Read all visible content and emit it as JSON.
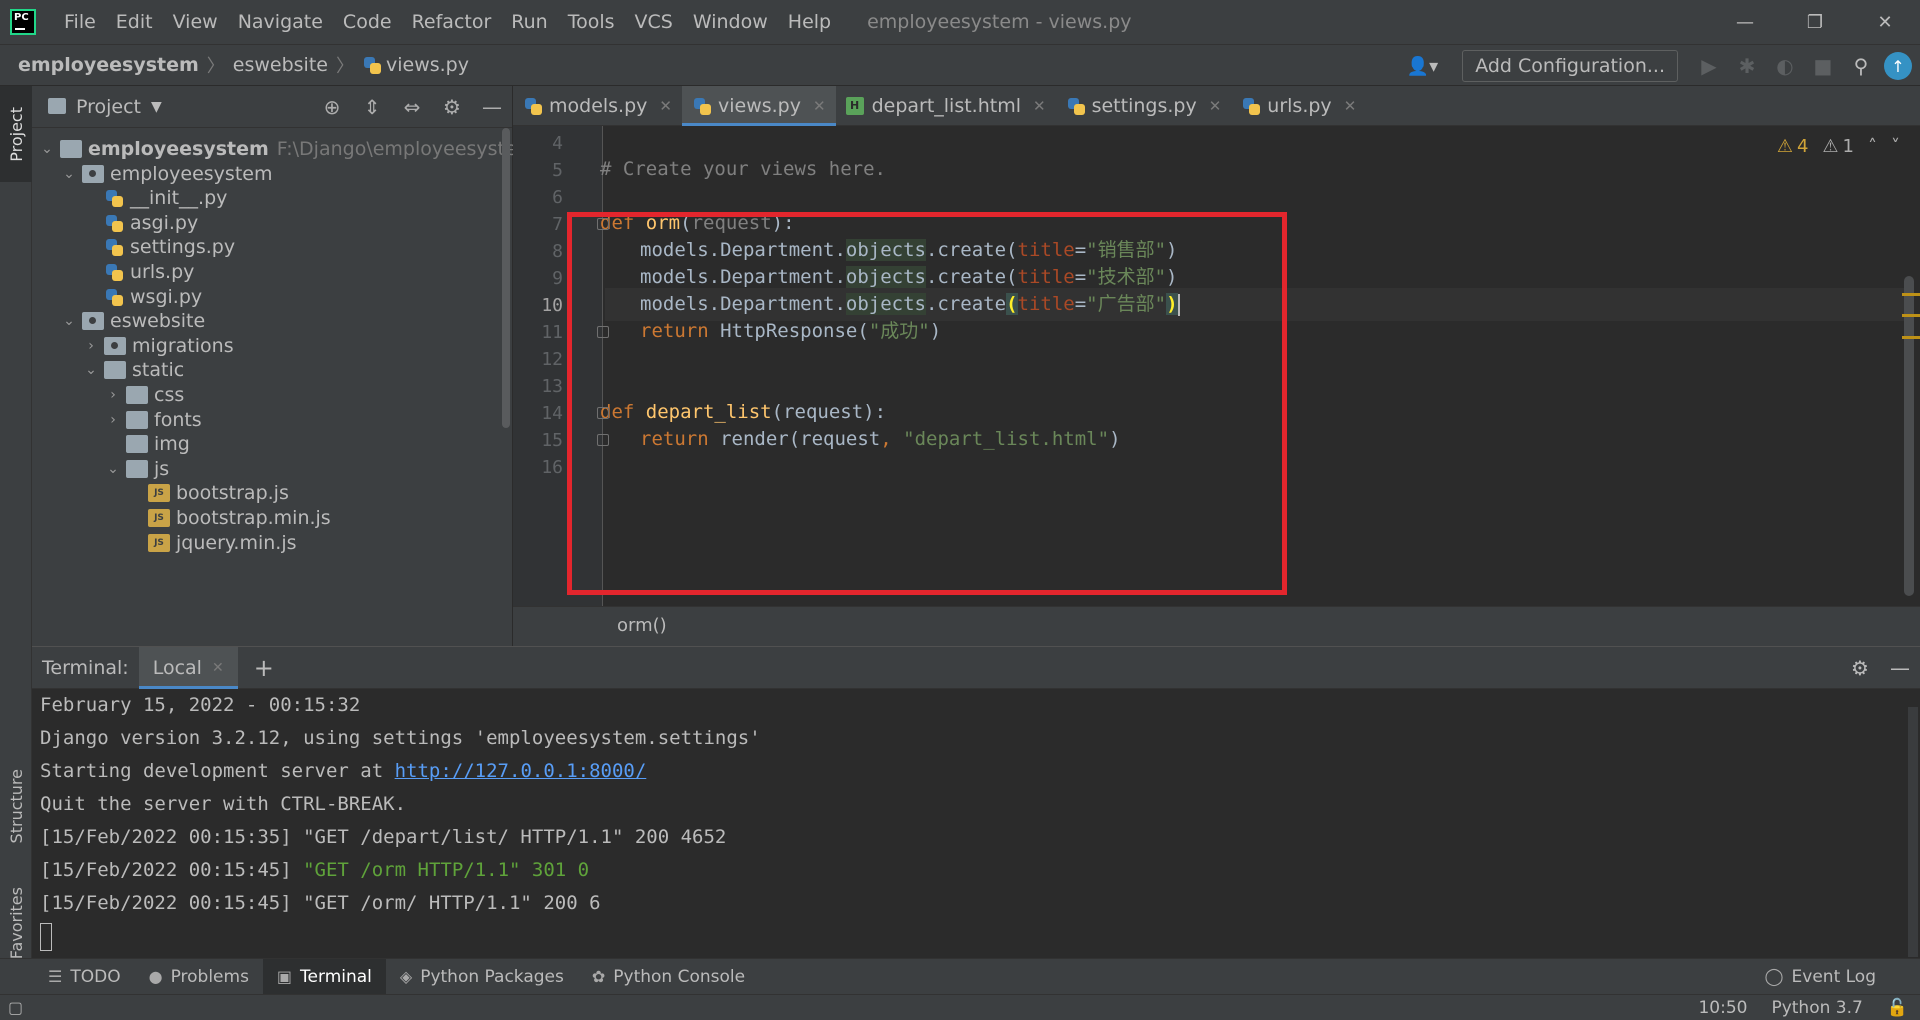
{
  "app": {
    "logo": "PC",
    "window_title": "employeesystem - views.py",
    "menu": [
      "File",
      "Edit",
      "View",
      "Navigate",
      "Code",
      "Refactor",
      "Run",
      "Tools",
      "VCS",
      "Window",
      "Help"
    ],
    "window_controls": {
      "minimize": "—",
      "restore": "❐",
      "close": "✕"
    }
  },
  "navbar": {
    "crumbs": [
      "employeesystem",
      "eswebsite",
      "views.py"
    ],
    "add_configuration": "Add Configuration..."
  },
  "side_tabs": {
    "project": "Project",
    "structure": "Structure",
    "favorites": "Favorites"
  },
  "project": {
    "title": "Project",
    "tree": [
      {
        "label": "employeesystem",
        "sub": "F:\\Django\\employeesystem",
        "type": "folder",
        "arrow": "v"
      },
      {
        "label": "employeesystem",
        "type": "pkg",
        "arrow": "v"
      },
      {
        "label": "__init__.py",
        "type": "py"
      },
      {
        "label": "asgi.py",
        "type": "py"
      },
      {
        "label": "settings.py",
        "type": "py"
      },
      {
        "label": "urls.py",
        "type": "py"
      },
      {
        "label": "wsgi.py",
        "type": "py"
      },
      {
        "label": "eswebsite",
        "type": "pkg",
        "arrow": "v"
      },
      {
        "label": "migrations",
        "type": "pkg",
        "arrow": ">"
      },
      {
        "label": "static",
        "type": "folder",
        "arrow": "v"
      },
      {
        "label": "css",
        "type": "folder",
        "arrow": ">"
      },
      {
        "label": "fonts",
        "type": "folder",
        "arrow": ">"
      },
      {
        "label": "img",
        "type": "folder"
      },
      {
        "label": "js",
        "type": "folder",
        "arrow": "v"
      },
      {
        "label": "bootstrap.js",
        "type": "js"
      },
      {
        "label": "bootstrap.min.js",
        "type": "js"
      },
      {
        "label": "jquery.min.js",
        "type": "js"
      }
    ]
  },
  "editor": {
    "tabs": [
      {
        "label": "models.py",
        "type": "py"
      },
      {
        "label": "views.py",
        "type": "py",
        "active": true
      },
      {
        "label": "depart_list.html",
        "type": "html"
      },
      {
        "label": "settings.py",
        "type": "py"
      },
      {
        "label": "urls.py",
        "type": "py"
      }
    ],
    "line_numbers": [
      "4",
      "5",
      "6",
      "7",
      "8",
      "9",
      "10",
      "11",
      "12",
      "13",
      "14",
      "15",
      "16"
    ],
    "current_line": "10",
    "code": {
      "comment": "# Create your views here.",
      "def_kw": "def",
      "orm_fn": "orm",
      "orm_param": "request",
      "models_prefix": "models.Department.",
      "objects": "objects",
      "create_call": ".create(",
      "title_kw": "title",
      "eq": "=",
      "dept1": "\"销售部\"",
      "dept2": "\"技术部\"",
      "dept3": "\"广告部\"",
      "return_kw": "return",
      "http_response": "HttpResponse(",
      "success": "\"成功\"",
      "depart_fn": "depart_list",
      "render_call": "render(request",
      "template": "\"depart_list.html\""
    },
    "warnings": {
      "warn_count": "4",
      "weak_count": "1"
    },
    "breadcrumb": "orm()"
  },
  "terminal": {
    "label": "Terminal:",
    "tab": "Local",
    "lines": [
      "February 15, 2022 - 00:15:32",
      "Django version 3.2.12, using settings 'employeesystem.settings'",
      "Starting development server at ",
      "Quit the server with CTRL-BREAK.",
      "[15/Feb/2022 00:15:35] \"GET /depart/list/ HTTP/1.1\" 200 4652",
      "[15/Feb/2022 00:15:45] ",
      "[15/Feb/2022 00:15:45] \"GET /orm/ HTTP/1.1\" 200 6"
    ],
    "server_url": "http://127.0.0.1:8000/",
    "redirect_line": "\"GET /orm HTTP/1.1\" 301 0"
  },
  "bottom_tabs": [
    {
      "label": "TODO",
      "icon": "list-icon"
    },
    {
      "label": "Problems",
      "icon": "problems-icon"
    },
    {
      "label": "Terminal",
      "icon": "terminal-icon",
      "active": true
    },
    {
      "label": "Python Packages",
      "icon": "packages-icon"
    },
    {
      "label": "Python Console",
      "icon": "python-console-icon"
    }
  ],
  "event_log": "Event Log",
  "status": {
    "position": "10:50",
    "interpreter": "Python 3.7"
  },
  "colors": {
    "accent": "#4a88c7",
    "highlight_box": "#e3262d",
    "keyword": "#cc7832",
    "string": "#6a8759",
    "function": "#ffc66d"
  }
}
